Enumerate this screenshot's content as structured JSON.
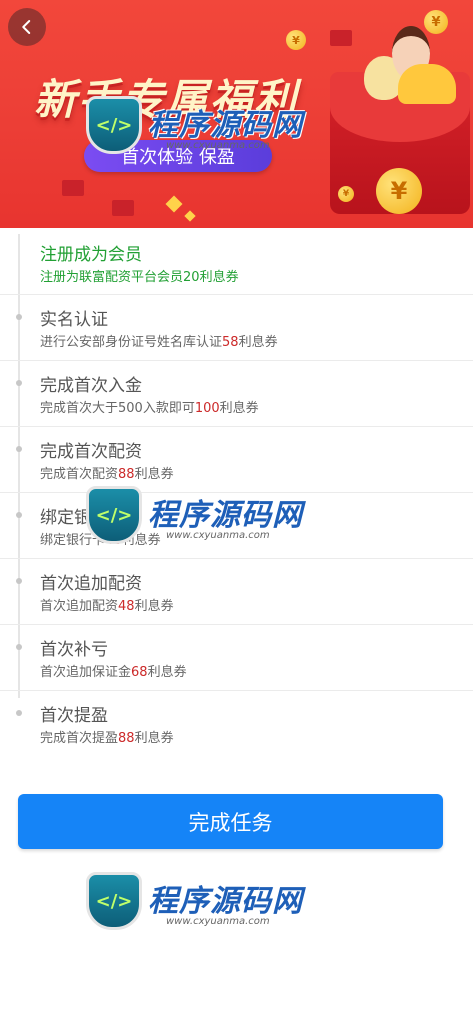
{
  "header": {
    "title": "新手专属福利",
    "pill": "首次体验 保盈",
    "coin_symbol": "¥"
  },
  "tasks": [
    {
      "title": "注册成为会员",
      "desc_prefix": "注册为联富配资平台会员",
      "amount": "20",
      "desc_suffix": "利息券",
      "done": true
    },
    {
      "title": "实名认证",
      "desc_prefix": "进行公安部身份证号姓名库认证",
      "amount": "58",
      "desc_suffix": "利息券",
      "done": false
    },
    {
      "title": "完成首次入金",
      "desc_prefix": "完成首次大于500入款即可",
      "amount": "100",
      "desc_suffix": "利息券",
      "done": false
    },
    {
      "title": "完成首次配资",
      "desc_prefix": "完成首次配资",
      "amount": "88",
      "desc_suffix": "利息券",
      "done": false
    },
    {
      "title": "绑定银行卡",
      "desc_prefix": "绑定银行卡",
      "amount": "48",
      "desc_suffix": "利息券",
      "done": false
    },
    {
      "title": "首次追加配资",
      "desc_prefix": "首次追加配资",
      "amount": "48",
      "desc_suffix": "利息券",
      "done": false
    },
    {
      "title": "首次补亏",
      "desc_prefix": "首次追加保证金",
      "amount": "68",
      "desc_suffix": "利息券",
      "done": false
    },
    {
      "title": "首次提盈",
      "desc_prefix": "完成首次提盈",
      "amount": "88",
      "desc_suffix": "利息券",
      "done": false
    }
  ],
  "actions": {
    "complete_label": "完成任务"
  },
  "watermark": {
    "brand": "程序源码网",
    "url": "www.cxyuanma.com"
  },
  "colors": {
    "banner_red": "#ec3e36",
    "done_green": "#22a034",
    "amount_red": "#cc2a2a",
    "button_blue": "#1584f7"
  },
  "icons": {
    "back": "chevron-left-icon"
  }
}
